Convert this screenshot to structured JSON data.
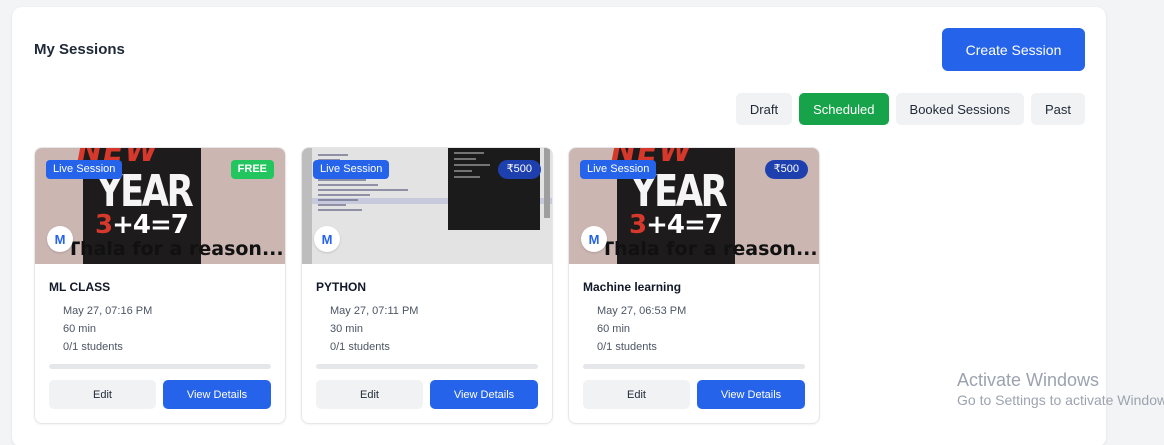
{
  "header": {
    "title": "My Sessions",
    "create_label": "Create Session"
  },
  "filters": [
    "Draft",
    "Scheduled",
    "Booked Sessions",
    "Past"
  ],
  "active_filter": "Scheduled",
  "colors": {
    "primary": "#2563eb",
    "active_filter": "#16a34a",
    "free_badge": "#22c55e",
    "price_badge": "#1e40af"
  },
  "thumbnail_text": {
    "new": "NEW",
    "year": "YEAR",
    "eq_num": "3",
    "eq_rest": "+4=7",
    "tagline": "Thala for a reason..."
  },
  "sessions": [
    {
      "type_badge": "Live Session",
      "price": "FREE",
      "avatar": "M",
      "title": "ML CLASS",
      "date": "May 27, 07:16 PM",
      "duration": "60 min",
      "students": "0/1 students",
      "booked_fraction": 0,
      "edit_label": "Edit",
      "view_label": "View Details"
    },
    {
      "type_badge": "Live Session",
      "price": "₹500",
      "avatar": "M",
      "title": "PYTHON",
      "date": "May 27, 07:11 PM",
      "duration": "30 min",
      "students": "0/1 students",
      "booked_fraction": 0,
      "edit_label": "Edit",
      "view_label": "View Details"
    },
    {
      "type_badge": "Live Session",
      "price": "₹500",
      "avatar": "M",
      "title": "Machine learning",
      "date": "May 27, 06:53 PM",
      "duration": "60 min",
      "students": "0/1 students",
      "booked_fraction": 0,
      "edit_label": "Edit",
      "view_label": "View Details"
    }
  ],
  "watermark": {
    "title": "Activate Windows",
    "subtitle": "Go to Settings to activate Windows."
  }
}
